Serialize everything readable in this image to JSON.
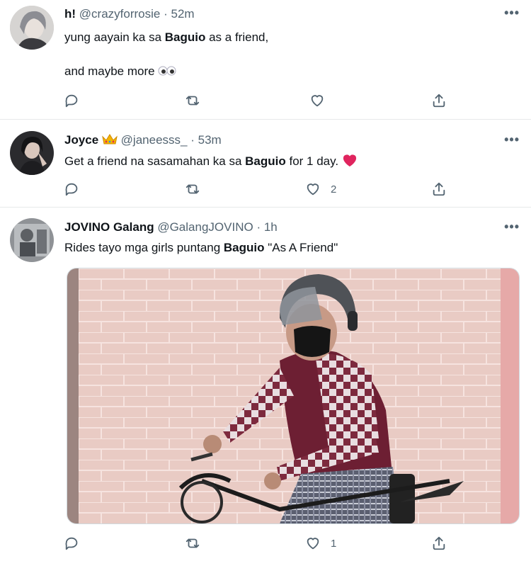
{
  "tweets": [
    {
      "name": "h!",
      "handle": "@crazyforrosie",
      "dot": "·",
      "time": "52m",
      "text_pre": "yung aayain ka sa ",
      "text_bold": "Baguio",
      "text_post": " as a friend,",
      "text_line2": "and maybe more",
      "emoji": "eyes-emoji",
      "likes": ""
    },
    {
      "name": "Joyce",
      "name_emoji": "crown-emoji",
      "handle": "@janeesss_",
      "dot": "·",
      "time": "53m",
      "text_pre": "Get a friend na sasamahan ka sa ",
      "text_bold": "Baguio",
      "text_post": " for 1 day.",
      "emoji": "red-heart-emoji",
      "likes": "2"
    },
    {
      "name": "JOVINO Galang",
      "handle": "@GalangJOVINO",
      "dot": "·",
      "time": "1h",
      "text_pre": "Rides tayo mga girls puntang ",
      "text_bold": "Baguio",
      "text_post": " \"As A Friend\"",
      "media": "photo-man-on-bicycle-with-helmet",
      "likes": "1"
    }
  ],
  "colors": {
    "text": "#0f1419",
    "muted": "#536471",
    "divider": "#e7e9ea",
    "heart": "#e0245e"
  },
  "icons": [
    "reply-icon",
    "retweet-icon",
    "like-icon",
    "share-icon",
    "more-icon"
  ]
}
